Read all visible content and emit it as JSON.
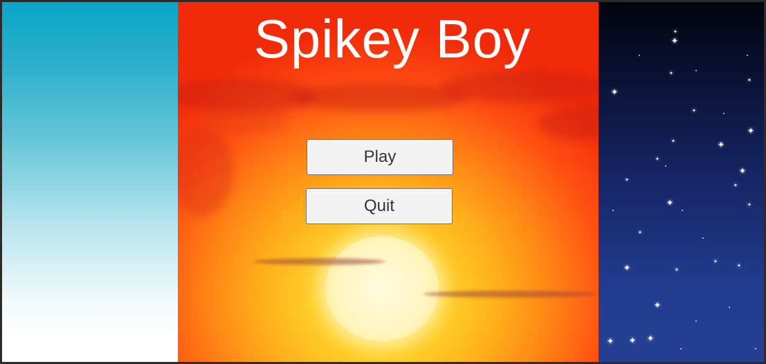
{
  "game": {
    "title": "Spikey Boy",
    "menu": {
      "play_label": "Play",
      "quit_label": "Quit"
    }
  },
  "panels": {
    "left": "day-sky",
    "center": "sunset",
    "right": "night-sky"
  },
  "colors": {
    "title_text": "#ffffff",
    "button_bg": "#f3f3f3",
    "button_text": "#333333",
    "sky_top": "#0aa5c6",
    "sunset_top": "#f12a0a",
    "sun": "#fff6c2",
    "night_top": "#02030c",
    "night_bottom": "#263f93"
  }
}
